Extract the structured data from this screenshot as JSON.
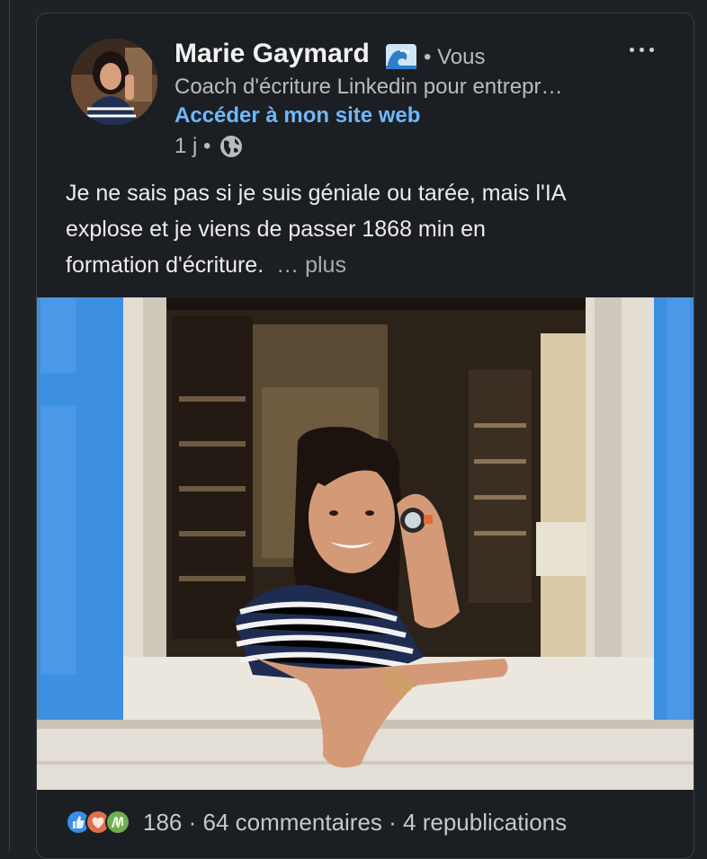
{
  "post": {
    "author": {
      "name": "Marie Gaymard",
      "badge_icon": "wave-emoji-icon",
      "relation": "• Vous",
      "headline": "Coach d'écriture Linkedin pour entrepr…",
      "link_label": "Accéder à mon site web",
      "time": "1 j •"
    },
    "text_lines": [
      "Je ne sais pas si je suis géniale ou tarée, mais l'IA",
      "explose et je viens de passer 1868 min en",
      "formation d'écriture."
    ],
    "more_label": "… plus",
    "social": {
      "reaction_icons": [
        "like-icon",
        "love-icon",
        "celebrate-icon"
      ],
      "reactions_count": "186",
      "separator": " · ",
      "comments": "64 commentaires",
      "reposts": "4 republications"
    }
  },
  "colors": {
    "background": "#1d2226",
    "card": "#1b1f23",
    "link": "#71b7fb",
    "shutter_blue": "#3d8fe0"
  }
}
